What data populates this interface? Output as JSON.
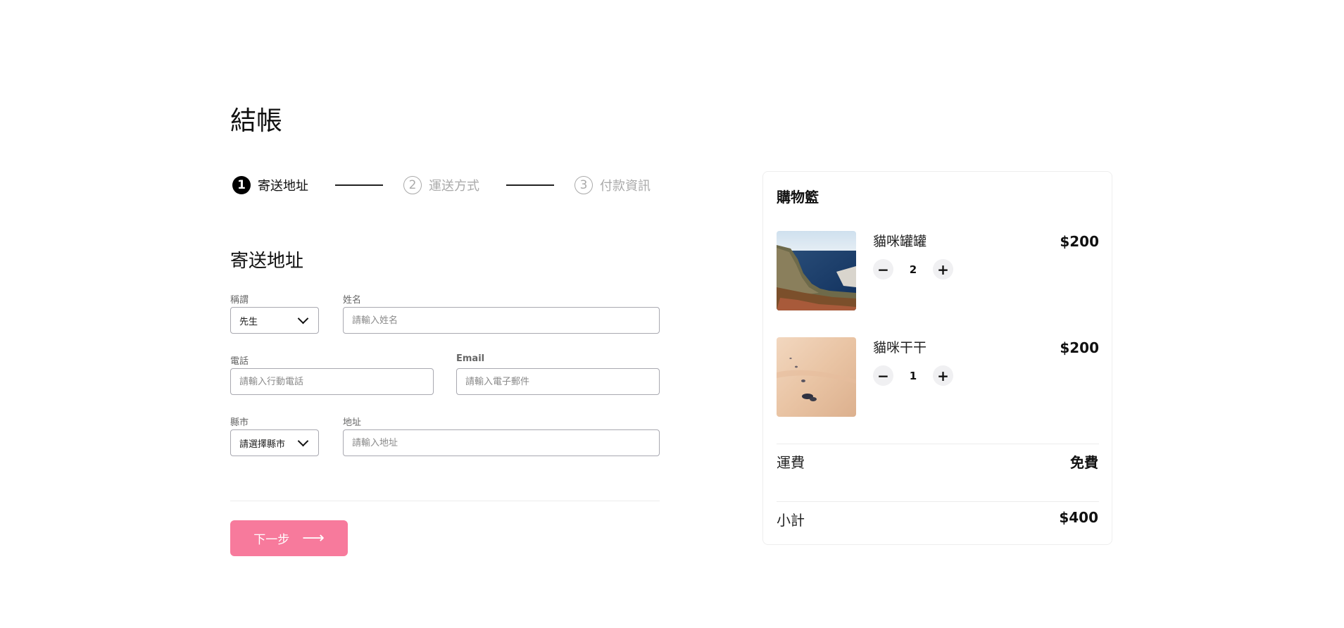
{
  "page_title": "結帳",
  "stepper": {
    "steps": [
      {
        "number": "1",
        "label": "寄送地址"
      },
      {
        "number": "2",
        "label": "運送方式"
      },
      {
        "number": "3",
        "label": "付款資訊"
      }
    ]
  },
  "form": {
    "section_title": "寄送地址",
    "title_field": {
      "label": "稱謂",
      "value": "先生"
    },
    "name_field": {
      "label": "姓名",
      "placeholder": "請輸入姓名"
    },
    "phone_field": {
      "label": "電話",
      "placeholder": "請輸入行動電話"
    },
    "email_field": {
      "label": "Email",
      "placeholder": "請輸入電子郵件"
    },
    "city_field": {
      "label": "縣市",
      "value": "請選擇縣市"
    },
    "address_field": {
      "label": "地址",
      "placeholder": "請輸入地址"
    }
  },
  "next_button": {
    "label": "下一步",
    "arrow": "⟶"
  },
  "cart": {
    "title": "購物籃",
    "items": [
      {
        "name": "貓咪罐罐",
        "quantity": "2",
        "price": "$200",
        "image_icon": "coastal-cliff-photo"
      },
      {
        "name": "貓咪干干",
        "quantity": "1",
        "price": "$200",
        "image_icon": "sand-dune-photo"
      }
    ],
    "shipping": {
      "label": "運費",
      "value": "免費"
    },
    "subtotal": {
      "label": "小計",
      "value": "$400"
    }
  },
  "colors": {
    "accent": "#f77a9c",
    "active_step": "#000000",
    "inactive_step": "#aaaaaa"
  }
}
